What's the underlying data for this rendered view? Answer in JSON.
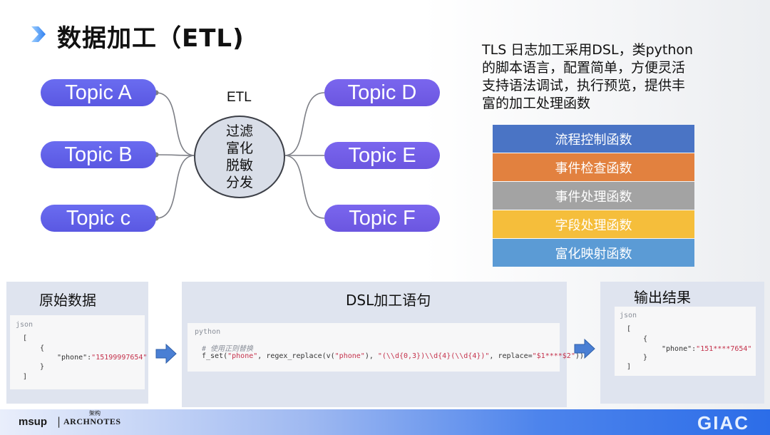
{
  "header": {
    "title": "数据加工（ETL)"
  },
  "topics_left": [
    "Topic A",
    "Topic B",
    "Topic c"
  ],
  "topics_right": [
    "Topic D",
    "Topic E",
    "Topic F"
  ],
  "etl": {
    "label": "ETL",
    "steps": [
      "过滤",
      "富化",
      "脱敏",
      "分发"
    ]
  },
  "description": {
    "lines": [
      "TLS 日志加工采用DSL，类python",
      "的脚本语言，配置简单，方便灵活",
      "支持语法调试，执行预览，提供丰",
      "富的加工处理函数"
    ]
  },
  "functions": [
    {
      "label": "流程控制函数",
      "color": "#4a74c5"
    },
    {
      "label": "事件检查函数",
      "color": "#e2813f"
    },
    {
      "label": "事件处理函数",
      "color": "#a3a3a3"
    },
    {
      "label": "字段处理函数",
      "color": "#f5be3b"
    },
    {
      "label": "富化映射函数",
      "color": "#5b9bd5"
    }
  ],
  "raw_panel": {
    "title": "原始数据",
    "lang": "json",
    "open_bracket": "[",
    "open_brace": "{",
    "key": "\"phone\":",
    "value": "\"15199997654\"",
    "close_brace": "}",
    "close_bracket": "]"
  },
  "dsl_panel": {
    "title": "DSL加工语句",
    "lang": "python",
    "comment": "# 使用正则替换",
    "code": {
      "p1": "f_set(",
      "s1": "\"phone\"",
      "p2": ", regex_replace(v(",
      "s2": "\"phone\"",
      "p3": "), ",
      "s3": "\"(\\\\d{0,3})\\\\d{4}(\\\\d{4})\"",
      "p4": ", replace=",
      "s4": "\"$1****$2\"",
      "p5": "))"
    }
  },
  "result_panel": {
    "title": "输出结果",
    "lang": "json",
    "open_bracket": "[",
    "open_brace": "{",
    "key": "\"phone\":",
    "value": "\"151****7654\"",
    "close_brace": "}",
    "close_bracket": "]"
  },
  "footer": {
    "brand_left": "msup",
    "separator": "|",
    "brand_arch": "ARCHNOTES",
    "brand_arch_cn": "架构",
    "brand_right": "GIAC"
  },
  "colors": {
    "pill": "#5f5fe8",
    "arrow": "#4a7fd4",
    "title_arrow": "#3a8ef0"
  }
}
